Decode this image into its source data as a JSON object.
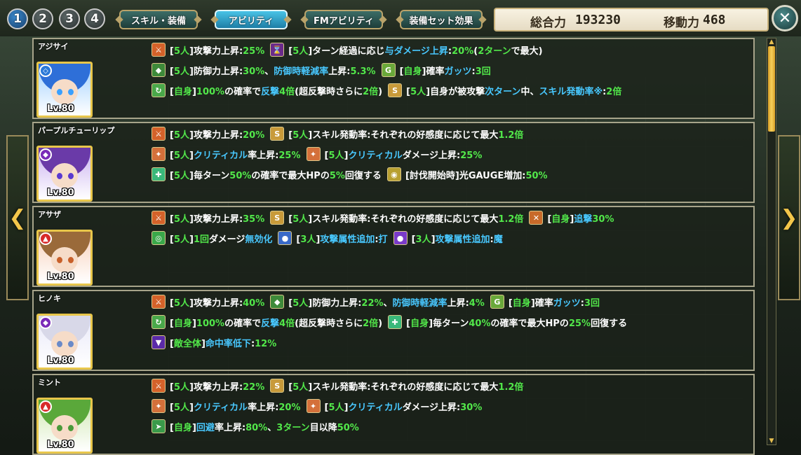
{
  "header": {
    "party_numbers": [
      "1",
      "2",
      "3",
      "4"
    ],
    "tabs": [
      {
        "label": "スキル・装備",
        "active": false
      },
      {
        "label": "アビリティ",
        "active": true
      },
      {
        "label": "FMアビリティ",
        "active": false
      },
      {
        "label": "装備セット効果",
        "active": false
      }
    ],
    "power_label": "総合力",
    "power_value": "193230",
    "move_label": "移動力",
    "move_value": "468",
    "close_icon": "close-icon"
  },
  "colors": {
    "white": "#ffffff",
    "green": "#52e84a",
    "cyan": "#48c8ff",
    "yellow": "#f2d85a",
    "frame": "#a7a48a",
    "scroll_thumb": "#f6cf5a"
  },
  "characters": [
    {
      "name": "アジサイ",
      "level": "Lv.80",
      "attribute": "water",
      "abilities": [
        [
          {
            "icon": "attack-up-icon",
            "text": [
              [
                "w",
                "["
              ],
              [
                "g",
                "5人"
              ],
              [
                "w",
                "]攻撃力上昇:"
              ],
              [
                "g",
                "25%"
              ]
            ]
          },
          {
            "icon": "turn-damage-icon",
            "text": [
              [
                "w",
                "["
              ],
              [
                "g",
                "5人"
              ],
              [
                "w",
                "]ターン経過に応じ"
              ],
              [
                "c",
                "与ダメージ上昇"
              ],
              [
                "w",
                ":"
              ],
              [
                "g",
                "20%"
              ],
              [
                "w",
                "("
              ],
              [
                "g",
                "2ターン"
              ],
              [
                "w",
                "で最大)"
              ]
            ]
          }
        ],
        [
          {
            "icon": "defense-up-icon",
            "text": [
              [
                "w",
                "["
              ],
              [
                "g",
                "5人"
              ],
              [
                "w",
                "]防御力上昇:"
              ],
              [
                "g",
                "30%"
              ],
              [
                "w",
                "、"
              ],
              [
                "c",
                "防御時軽減率"
              ],
              [
                "w",
                "上昇:"
              ],
              [
                "g",
                "5.3%"
              ]
            ]
          },
          {
            "icon": "guts-icon",
            "text": [
              [
                "w",
                "["
              ],
              [
                "g",
                "自身"
              ],
              [
                "w",
                "]確率"
              ],
              [
                "c",
                "ガッツ"
              ],
              [
                "w",
                ":"
              ],
              [
                "g",
                "3回"
              ]
            ]
          }
        ],
        [
          {
            "icon": "counter-icon",
            "text": [
              [
                "w",
                "["
              ],
              [
                "g",
                "自身"
              ],
              [
                "w",
                "]"
              ],
              [
                "g",
                "100%"
              ],
              [
                "w",
                "の確率で"
              ],
              [
                "c",
                "反撃"
              ],
              [
                "g",
                "4倍"
              ],
              [
                "w",
                "(超反撃時さらに"
              ],
              [
                "g",
                "2倍"
              ],
              [
                "w",
                ")"
              ]
            ]
          },
          {
            "icon": "skill-rate-icon",
            "text": [
              [
                "w",
                "["
              ],
              [
                "g",
                "5人"
              ],
              [
                "w",
                "]自身が被攻撃"
              ],
              [
                "c",
                "次ターン"
              ],
              [
                "w",
                "中、"
              ],
              [
                "c",
                "スキル発動率※"
              ],
              [
                "w",
                ":"
              ],
              [
                "g",
                "2倍"
              ]
            ]
          }
        ]
      ]
    },
    {
      "name": "パープルチューリップ",
      "level": "Lv.80",
      "attribute": "dark",
      "abilities": [
        [
          {
            "icon": "attack-up-icon",
            "text": [
              [
                "w",
                "["
              ],
              [
                "g",
                "5人"
              ],
              [
                "w",
                "]攻撃力上昇:"
              ],
              [
                "g",
                "20%"
              ]
            ]
          },
          {
            "icon": "skill-rate-icon",
            "text": [
              [
                "w",
                "["
              ],
              [
                "g",
                "5人"
              ],
              [
                "w",
                "]スキル発動率:それぞれの好感度に応じて最大"
              ],
              [
                "g",
                "1.2倍"
              ]
            ]
          }
        ],
        [
          {
            "icon": "critical-icon",
            "text": [
              [
                "w",
                "["
              ],
              [
                "g",
                "5人"
              ],
              [
                "w",
                "]"
              ],
              [
                "c",
                "クリティカル"
              ],
              [
                "w",
                "率上昇:"
              ],
              [
                "g",
                "25%"
              ]
            ]
          },
          {
            "icon": "critical-icon",
            "text": [
              [
                "w",
                "["
              ],
              [
                "g",
                "5人"
              ],
              [
                "w",
                "]"
              ],
              [
                "c",
                "クリティカル"
              ],
              [
                "w",
                "ダメージ上昇:"
              ],
              [
                "g",
                "25%"
              ]
            ]
          }
        ],
        [
          {
            "icon": "heal-icon",
            "text": [
              [
                "w",
                "["
              ],
              [
                "g",
                "5人"
              ],
              [
                "w",
                "]毎ターン"
              ],
              [
                "g",
                "50%"
              ],
              [
                "w",
                "の確率で最大HPの"
              ],
              [
                "g",
                "5%"
              ],
              [
                "w",
                "回復する"
              ]
            ]
          },
          {
            "icon": "gauge-icon",
            "text": [
              [
                "w",
                "[討伐開始時]光GAUGE増加:"
              ],
              [
                "g",
                "50%"
              ]
            ]
          }
        ]
      ]
    },
    {
      "name": "アサザ",
      "level": "Lv.80",
      "attribute": "fire",
      "abilities": [
        [
          {
            "icon": "attack-up-icon",
            "text": [
              [
                "w",
                "["
              ],
              [
                "g",
                "5人"
              ],
              [
                "w",
                "]攻撃力上昇:"
              ],
              [
                "g",
                "35%"
              ]
            ]
          },
          {
            "icon": "skill-rate-icon",
            "text": [
              [
                "w",
                "["
              ],
              [
                "g",
                "5人"
              ],
              [
                "w",
                "]スキル発動率:それぞれの好感度に応じて最大"
              ],
              [
                "g",
                "1.2倍"
              ]
            ]
          },
          {
            "icon": "pursuit-icon",
            "text": [
              [
                "w",
                "["
              ],
              [
                "g",
                "自身"
              ],
              [
                "w",
                "]"
              ],
              [
                "c",
                "追撃"
              ],
              [
                "g",
                "30%"
              ]
            ]
          }
        ],
        [
          {
            "icon": "nullify-icon",
            "text": [
              [
                "w",
                "["
              ],
              [
                "g",
                "5人"
              ],
              [
                "w",
                "]"
              ],
              [
                "g",
                "1回"
              ],
              [
                "w",
                "ダメージ"
              ],
              [
                "c",
                "無効化"
              ]
            ]
          },
          {
            "icon": "element-blunt-icon",
            "text": [
              [
                "w",
                "["
              ],
              [
                "g",
                "3人"
              ],
              [
                "w",
                "]"
              ],
              [
                "c",
                "攻撃属性追加"
              ],
              [
                "w",
                ":"
              ],
              [
                "c",
                "打"
              ]
            ]
          },
          {
            "icon": "element-magic-icon",
            "text": [
              [
                "w",
                "["
              ],
              [
                "g",
                "3人"
              ],
              [
                "w",
                "]"
              ],
              [
                "c",
                "攻撃属性追加"
              ],
              [
                "w",
                ":"
              ],
              [
                "c",
                "魔"
              ]
            ]
          }
        ]
      ]
    },
    {
      "name": "ヒノキ",
      "level": "Lv.80",
      "attribute": "dark",
      "abilities": [
        [
          {
            "icon": "attack-up-icon",
            "text": [
              [
                "w",
                "["
              ],
              [
                "g",
                "5人"
              ],
              [
                "w",
                "]攻撃力上昇:"
              ],
              [
                "g",
                "40%"
              ]
            ]
          },
          {
            "icon": "defense-up-icon",
            "text": [
              [
                "w",
                "["
              ],
              [
                "g",
                "5人"
              ],
              [
                "w",
                "]防御力上昇:"
              ],
              [
                "g",
                "22%"
              ],
              [
                "w",
                "、"
              ],
              [
                "c",
                "防御時軽減率"
              ],
              [
                "w",
                "上昇:"
              ],
              [
                "g",
                "4%"
              ]
            ]
          },
          {
            "icon": "guts-icon",
            "text": [
              [
                "w",
                "["
              ],
              [
                "g",
                "自身"
              ],
              [
                "w",
                "]確率"
              ],
              [
                "c",
                "ガッツ"
              ],
              [
                "w",
                ":"
              ],
              [
                "g",
                "3回"
              ]
            ]
          }
        ],
        [
          {
            "icon": "counter-icon",
            "text": [
              [
                "w",
                "["
              ],
              [
                "g",
                "自身"
              ],
              [
                "w",
                "]"
              ],
              [
                "g",
                "100%"
              ],
              [
                "w",
                "の確率で"
              ],
              [
                "c",
                "反撃"
              ],
              [
                "g",
                "4倍"
              ],
              [
                "w",
                "(超反撃時さらに"
              ],
              [
                "g",
                "2倍"
              ],
              [
                "w",
                ")"
              ]
            ]
          },
          {
            "icon": "heal-icon",
            "text": [
              [
                "w",
                "["
              ],
              [
                "g",
                "自身"
              ],
              [
                "w",
                "]毎ターン"
              ],
              [
                "g",
                "40%"
              ],
              [
                "w",
                "の確率で最大HPの"
              ],
              [
                "g",
                "25%"
              ],
              [
                "w",
                "回復する"
              ]
            ]
          }
        ],
        [
          {
            "icon": "accuracy-down-icon",
            "text": [
              [
                "w",
                "["
              ],
              [
                "g",
                "敵全体"
              ],
              [
                "w",
                "]"
              ],
              [
                "c",
                "命中率低下"
              ],
              [
                "w",
                ":"
              ],
              [
                "g",
                "12%"
              ]
            ]
          }
        ]
      ]
    },
    {
      "name": "ミント",
      "level": "Lv.80",
      "attribute": "fire",
      "abilities": [
        [
          {
            "icon": "attack-up-icon",
            "text": [
              [
                "w",
                "["
              ],
              [
                "g",
                "5人"
              ],
              [
                "w",
                "]攻撃力上昇:"
              ],
              [
                "g",
                "22%"
              ]
            ]
          },
          {
            "icon": "skill-rate-icon",
            "text": [
              [
                "w",
                "["
              ],
              [
                "g",
                "5人"
              ],
              [
                "w",
                "]スキル発動率:それぞれの好感度に応じて最大"
              ],
              [
                "g",
                "1.2倍"
              ]
            ]
          }
        ],
        [
          {
            "icon": "critical-icon",
            "text": [
              [
                "w",
                "["
              ],
              [
                "g",
                "5人"
              ],
              [
                "w",
                "]"
              ],
              [
                "c",
                "クリティカル"
              ],
              [
                "w",
                "率上昇:"
              ],
              [
                "g",
                "20%"
              ]
            ]
          },
          {
            "icon": "critical-icon",
            "text": [
              [
                "w",
                "["
              ],
              [
                "g",
                "5人"
              ],
              [
                "w",
                "]"
              ],
              [
                "c",
                "クリティカル"
              ],
              [
                "w",
                "ダメージ上昇:"
              ],
              [
                "g",
                "30%"
              ]
            ]
          }
        ],
        [
          {
            "icon": "evasion-icon",
            "text": [
              [
                "w",
                "["
              ],
              [
                "g",
                "自身"
              ],
              [
                "w",
                "]"
              ],
              [
                "c",
                "回避"
              ],
              [
                "w",
                "率上昇:"
              ],
              [
                "g",
                "80%"
              ],
              [
                "w",
                "、"
              ],
              [
                "g",
                "3ターン"
              ],
              [
                "w",
                "目以降"
              ],
              [
                "g",
                "50%"
              ]
            ]
          }
        ]
      ]
    }
  ]
}
